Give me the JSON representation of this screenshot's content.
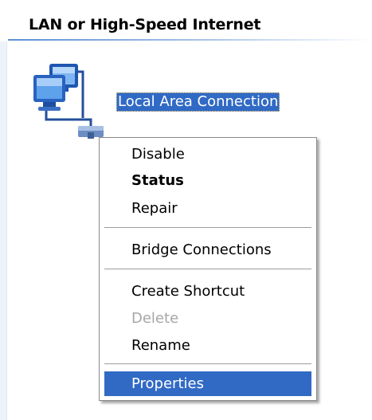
{
  "group": {
    "title": "LAN or High-Speed Internet"
  },
  "connection": {
    "label": "Local Area Connection",
    "icon": "network-connection-icon",
    "selected": true
  },
  "context_menu": {
    "items": [
      {
        "label": "Disable",
        "bold": false,
        "enabled": true,
        "highlighted": false
      },
      {
        "label": "Status",
        "bold": true,
        "enabled": true,
        "highlighted": false
      },
      {
        "label": "Repair",
        "bold": false,
        "enabled": true,
        "highlighted": false
      },
      {
        "label": "Bridge Connections",
        "bold": false,
        "enabled": true,
        "highlighted": false
      },
      {
        "label": "Create Shortcut",
        "bold": false,
        "enabled": true,
        "highlighted": false
      },
      {
        "label": "Delete",
        "bold": false,
        "enabled": false,
        "highlighted": false
      },
      {
        "label": "Rename",
        "bold": false,
        "enabled": true,
        "highlighted": false
      },
      {
        "label": "Properties",
        "bold": false,
        "enabled": true,
        "highlighted": true
      }
    ]
  },
  "colors": {
    "selection": "#316ac5",
    "disabled_text": "#a7a7a7",
    "header_rule": "#5c8fd6"
  }
}
